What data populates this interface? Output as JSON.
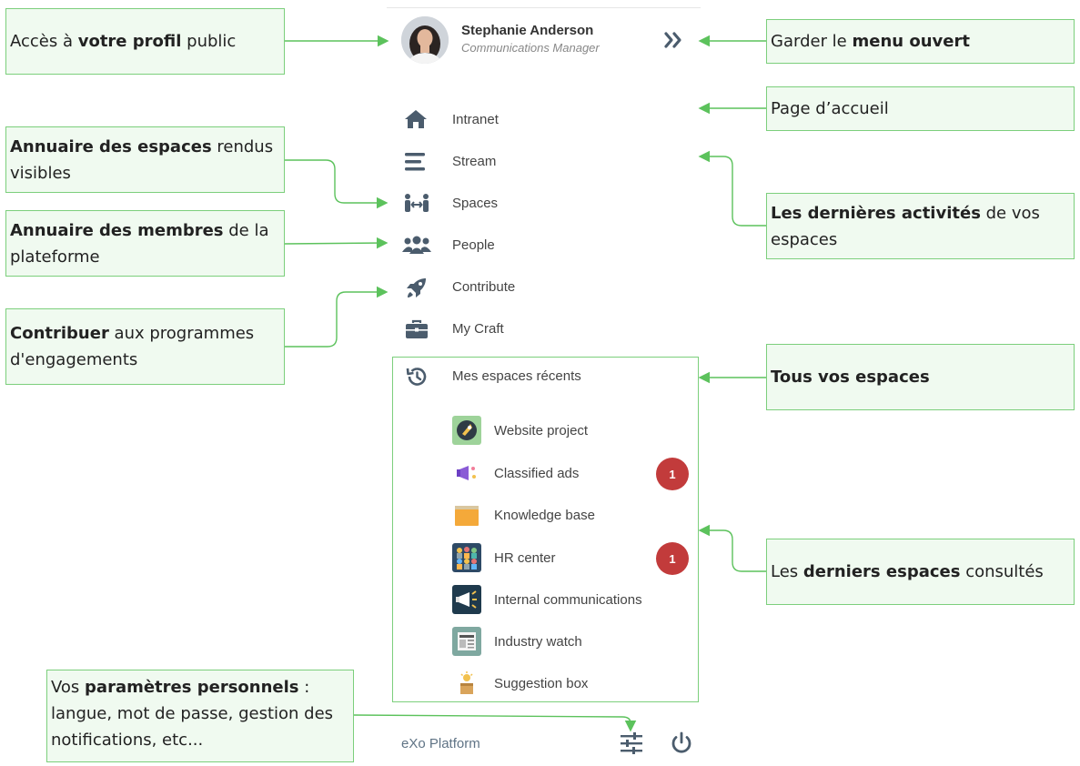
{
  "profile": {
    "name": "Stephanie Anderson",
    "role": "Communications Manager"
  },
  "menu": {
    "items": [
      {
        "label": "Intranet",
        "icon": "home-icon"
      },
      {
        "label": "Stream",
        "icon": "stream-icon"
      },
      {
        "label": "Spaces",
        "icon": "spaces-icon"
      },
      {
        "label": "People",
        "icon": "people-icon"
      },
      {
        "label": "Contribute",
        "icon": "rocket-icon"
      },
      {
        "label": "My Craft",
        "icon": "briefcase-icon"
      }
    ],
    "recent_header": "Mes espaces récents",
    "recent_spaces": [
      {
        "label": "Website project",
        "badge": ""
      },
      {
        "label": "Classified ads",
        "badge": "1"
      },
      {
        "label": "Knowledge base",
        "badge": ""
      },
      {
        "label": "HR center",
        "badge": "1"
      },
      {
        "label": "Internal communications",
        "badge": ""
      },
      {
        "label": "Industry watch",
        "badge": ""
      },
      {
        "label": "Suggestion box",
        "badge": ""
      }
    ],
    "footer_brand": "eXo Platform"
  },
  "colors": {
    "annotation_fill": "#f0faf0",
    "annotation_border": "#7ccf7c",
    "arrow": "#5cc25c",
    "badge": "#c23b3b",
    "icon": "#4b5c6d"
  },
  "annotations": {
    "profile": {
      "pre": "Accès à ",
      "bold": "votre profil",
      "post": " public"
    },
    "keep_open": {
      "pre": "Garder le ",
      "bold": "menu ouvert",
      "post": ""
    },
    "home": {
      "pre": "Page d’accueil",
      "bold": "",
      "post": ""
    },
    "spaces": {
      "pre": "",
      "bold": "Annuaire des espaces",
      "post": " rendus visibles"
    },
    "members": {
      "pre": "",
      "bold": "Annuaire des membres",
      "post": " de la plateforme"
    },
    "activities": {
      "pre": "",
      "bold": "Les dernières activités",
      "post": " de vos espaces"
    },
    "contribute": {
      "pre": "",
      "bold": "Contribuer",
      "post": " aux programmes d'engagements"
    },
    "all_spaces": {
      "pre": "",
      "bold": "Tous vos espaces",
      "post": ""
    },
    "last_spaces": {
      "pre": "Les ",
      "bold": "derniers espaces",
      "post": " consultés"
    },
    "settings": {
      "pre": "Vos ",
      "bold": "paramètres personnels",
      "post": " : langue, mot de passe, gestion des notifications, etc..."
    }
  }
}
